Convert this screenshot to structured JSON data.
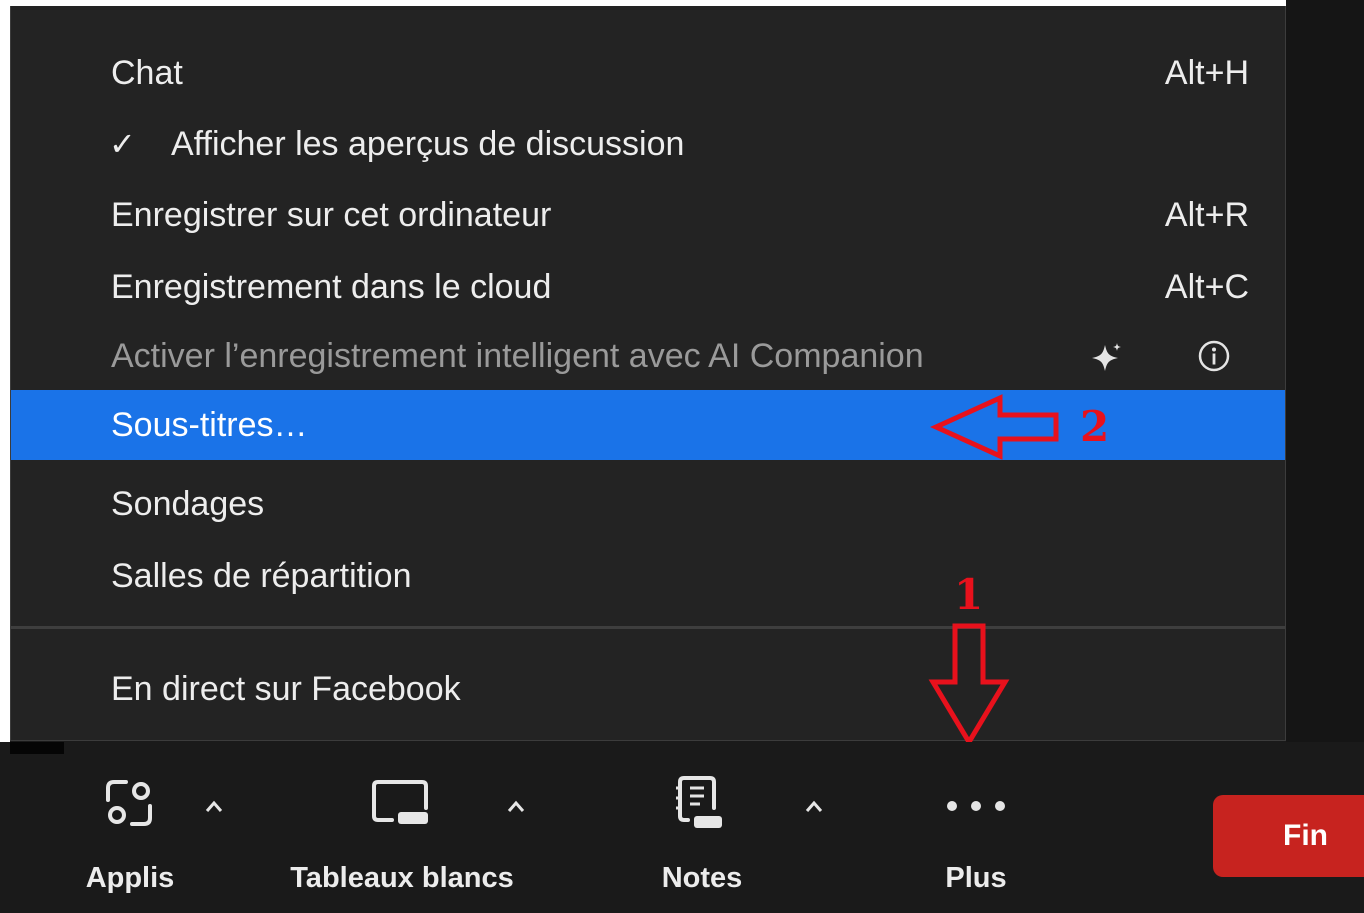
{
  "menu": {
    "items": [
      {
        "label": "Chat",
        "shortcut": "Alt+H"
      },
      {
        "label": "Afficher les aperçus de discussion",
        "checked": true
      },
      {
        "label": "Enregistrer sur cet ordinateur",
        "shortcut": "Alt+R"
      },
      {
        "label": "Enregistrement dans le cloud",
        "shortcut": "Alt+C"
      },
      {
        "label": "Activer l’enregistrement intelligent avec AI Companion",
        "disabled": true,
        "icons": [
          "sparkle-icon",
          "info-icon"
        ]
      },
      {
        "label": "Sous-titres…",
        "highlighted": true
      },
      {
        "label": "Sondages"
      },
      {
        "label": "Salles de répartition"
      },
      {
        "label": "En direct sur Facebook"
      }
    ],
    "check_glyph": "✓"
  },
  "annotations": {
    "step1": "1",
    "step2": "2",
    "color": "#e8111c"
  },
  "toolbar": {
    "tools": [
      {
        "label": "Applis",
        "icon": "apps-icon",
        "has_caret": true
      },
      {
        "label": "Tableaux blancs",
        "icon": "whiteboard-icon",
        "has_caret": true
      },
      {
        "label": "Notes",
        "icon": "notes-icon",
        "has_caret": true
      },
      {
        "label": "Plus",
        "icon": "more-icon",
        "has_caret": false
      }
    ],
    "end_button": "Fin"
  },
  "colors": {
    "menu_bg": "#232323",
    "highlight": "#1a73e8",
    "end_button": "#c7231f"
  }
}
